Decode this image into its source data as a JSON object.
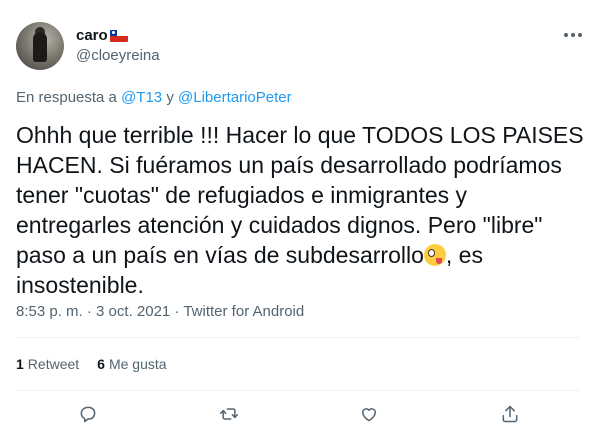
{
  "author": {
    "display_name": "caro",
    "handle": "@cloeyreina",
    "flag_icon": "chile-flag-icon"
  },
  "reply": {
    "prefix": "En respuesta a ",
    "mention1": "@T13",
    "connector": " y ",
    "mention2": "@LibertarioPeter"
  },
  "tweet": {
    "text_main": "Ohhh que terrible !!! Hacer lo que TODOS LOS PAISES HACEN. Si fuéramos un país desarrollado podríamos tener \"cuotas\" de refugiados e inmigrantes y entregarles atención y cuidados dignos. Pero \"libre\" paso a un país en vías de subdesarrollo",
    "emoji": "zany-face-emoji",
    "text_tail": ", es insostenible."
  },
  "meta": {
    "time": "8:53 p. m.",
    "date": "3 oct. 2021",
    "source": "Twitter for Android",
    "sep": " · "
  },
  "stats": {
    "retweets_count": "1",
    "retweets_label": "Retweet",
    "likes_count": "6",
    "likes_label": "Me gusta"
  },
  "colors": {
    "link": "#1d9bf0",
    "secondary_text": "#536471",
    "primary_text": "#0f1419"
  }
}
